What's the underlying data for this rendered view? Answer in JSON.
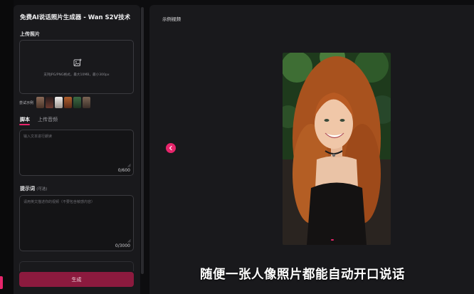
{
  "app": {
    "title": "免费AI说话照片生成器 - Wan S2V技术"
  },
  "upload": {
    "label": "上传照片",
    "hint": "支持JPG/PNG格式，最大10MB，最小300px",
    "icon": "image-add-icon"
  },
  "examples": {
    "label": "尝试示例",
    "thumb_colors": [
      "#6b4a3a",
      "#3b2a2a",
      "#d8d4d0",
      "#8a4a2e",
      "#2e4a34",
      "#5a4a40"
    ]
  },
  "tabs": [
    {
      "label": "脚本",
      "active": true
    },
    {
      "label": "上传音频",
      "active": false
    }
  ],
  "script": {
    "placeholder": "输入文本进行朗读",
    "count": "0/600"
  },
  "prompt": {
    "label": "提示词",
    "optional": "(可选)",
    "placeholder": "请用英文描述你的视频（不要包含敏感内容）",
    "count": "0/3000"
  },
  "actions": {
    "generate_label": "生成"
  },
  "preview": {
    "title": "示例视频",
    "caption": "随便一张人像照片都能自动开口说话"
  },
  "colors": {
    "accent": "#e6256b",
    "button": "#8c1a3e",
    "panel": "#19191c",
    "background": "#0d0d0f"
  }
}
